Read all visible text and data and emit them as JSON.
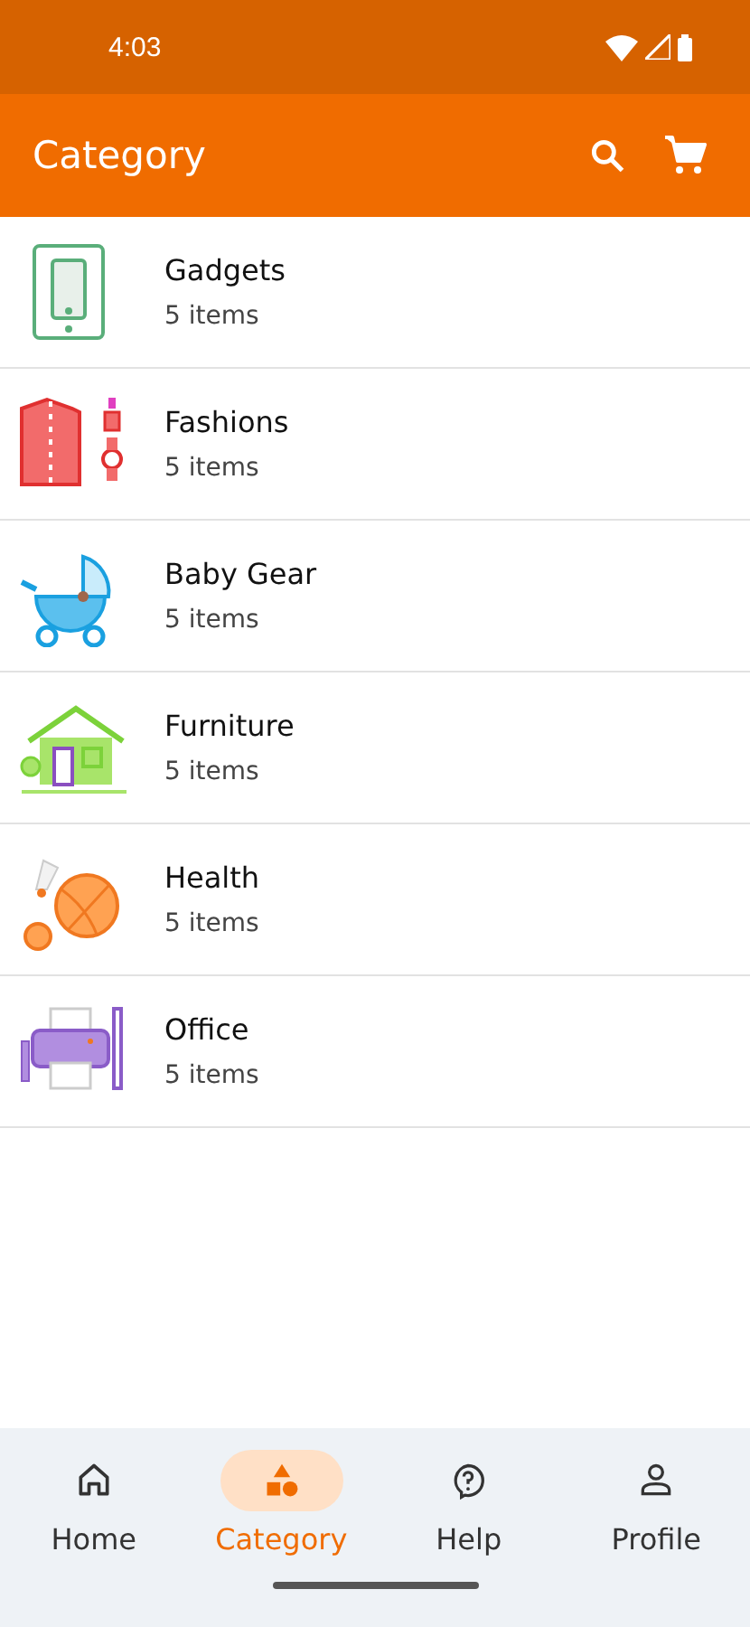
{
  "status_bar": {
    "time": "4:03"
  },
  "app_bar": {
    "title": "Category"
  },
  "categories": [
    {
      "kind": "gadgets",
      "name": "Gadgets",
      "count": "5 items"
    },
    {
      "kind": "fashions",
      "name": "Fashions",
      "count": "5 items"
    },
    {
      "kind": "baby",
      "name": "Baby Gear",
      "count": "5 items"
    },
    {
      "kind": "furniture",
      "name": "Furniture",
      "count": "5 items"
    },
    {
      "kind": "health",
      "name": "Health",
      "count": "5 items"
    },
    {
      "kind": "office",
      "name": "Office",
      "count": "5 items"
    }
  ],
  "nav": [
    {
      "kind": "home",
      "label": "Home",
      "selected": false
    },
    {
      "kind": "category",
      "label": "Category",
      "selected": true
    },
    {
      "kind": "help",
      "label": "Help",
      "selected": false
    },
    {
      "kind": "profile",
      "label": "Profile",
      "selected": false
    }
  ]
}
